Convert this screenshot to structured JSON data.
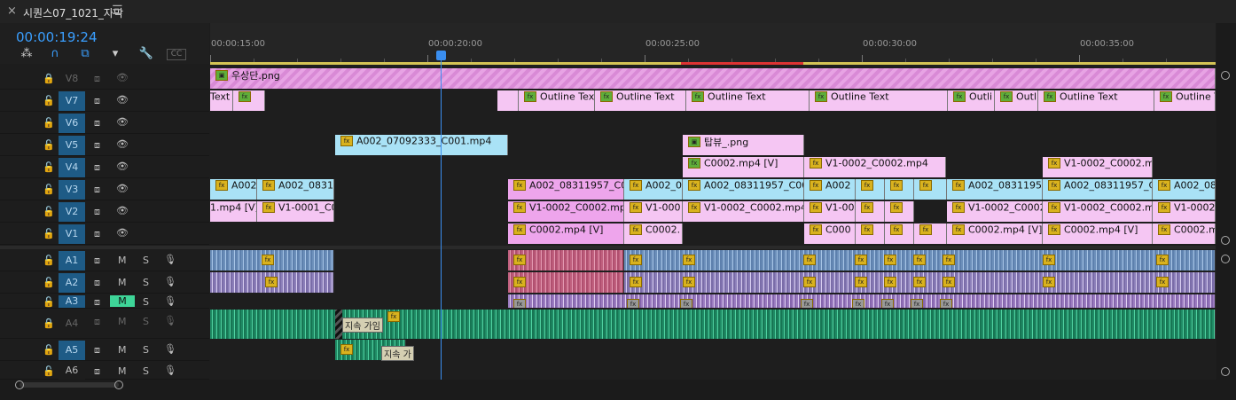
{
  "tab": {
    "title": "시퀀스07_1021_자막",
    "close": "×",
    "menu": "☰"
  },
  "timecode": "00:00:19:24",
  "toolbar": {
    "snap": "⁂",
    "magnet": "∩",
    "linked": "⧉",
    "marker": "▾",
    "wrench": "🔧",
    "captions": "CC"
  },
  "ruler": {
    "labels": [
      "00:00:15:00",
      "00:00:20:00",
      "00:00:25:00",
      "00:00:30:00",
      "00:00:35:00"
    ]
  },
  "video_tracks": [
    {
      "name": "V8",
      "enabled": false
    },
    {
      "name": "V7",
      "enabled": true
    },
    {
      "name": "V6",
      "enabled": true
    },
    {
      "name": "V5",
      "enabled": true
    },
    {
      "name": "V4",
      "enabled": true
    },
    {
      "name": "V3",
      "enabled": true
    },
    {
      "name": "V2",
      "enabled": true
    },
    {
      "name": "V1",
      "enabled": true
    }
  ],
  "audio_tracks": [
    {
      "name": "A1",
      "m": "M",
      "s": "S"
    },
    {
      "name": "A2",
      "m": "M",
      "s": "S"
    },
    {
      "name": "A3",
      "m": "M",
      "s": "S",
      "muted": true
    },
    {
      "name": "A4",
      "m": "M",
      "s": "S",
      "disabled": true
    },
    {
      "name": "A5",
      "m": "M",
      "s": "S"
    },
    {
      "name": "A6",
      "m": "M",
      "s": "S"
    }
  ],
  "clips": {
    "v8_0": "우상단.png",
    "v7_0": "Text",
    "v7_2": "Outline Text",
    "v7_3": "Outline Text",
    "v7_4": "Outline Text",
    "v7_5": "Outline Text",
    "v7_6": "Outli",
    "v7_7": "Outl",
    "v7_8": "Outline Text",
    "v7_9": "Outline Text",
    "v5_0": "A002_07092333_C001.mp4",
    "v5_1": "탑뷰_.png",
    "v4_0": "C0002.mp4 [V]",
    "v4_1": "V1-0002_C0002.mp4",
    "v4_2": "V1-0002_C0002.mp",
    "v3_0": "A002",
    "v3_1": "A002_08311",
    "v3_2": "A002_08311957_C00",
    "v3_3": "A002_0",
    "v3_4": "A002_08311957_C008.",
    "v3_5": "A002",
    "v3_6": "A002_08311957",
    "v3_7": "A002_08311957_C0",
    "v3_8": "A002_08",
    "v2_0": "1.mp4 [V]",
    "v2_1": "V1-0001_C0",
    "v2_2": "V1-0002_C0002.mp4 [",
    "v2_3": "V1-000",
    "v2_4": "V1-0002_C0002.mp4 [V",
    "v2_5": "V1-00",
    "v2_6": "V1-0002_C0002.",
    "v2_7": "V1-0002_C0002.mp",
    "v2_8": "V1-0002_",
    "v1_0": "C0002.mp4 [V]",
    "v1_1": "C0002.",
    "v1_2": "C000",
    "v1_3": "C0002.mp4 [V]",
    "v1_4": "C0002.mp4 [V]",
    "v1_5": "C0002.m",
    "a4_label": "지속 가임",
    "a5_label": "지속 가"
  },
  "colors": {
    "accent": "#3a9fff",
    "track_target": "#1e5b86",
    "mute_on": "#3ed598",
    "work_area": "#d4c455"
  }
}
